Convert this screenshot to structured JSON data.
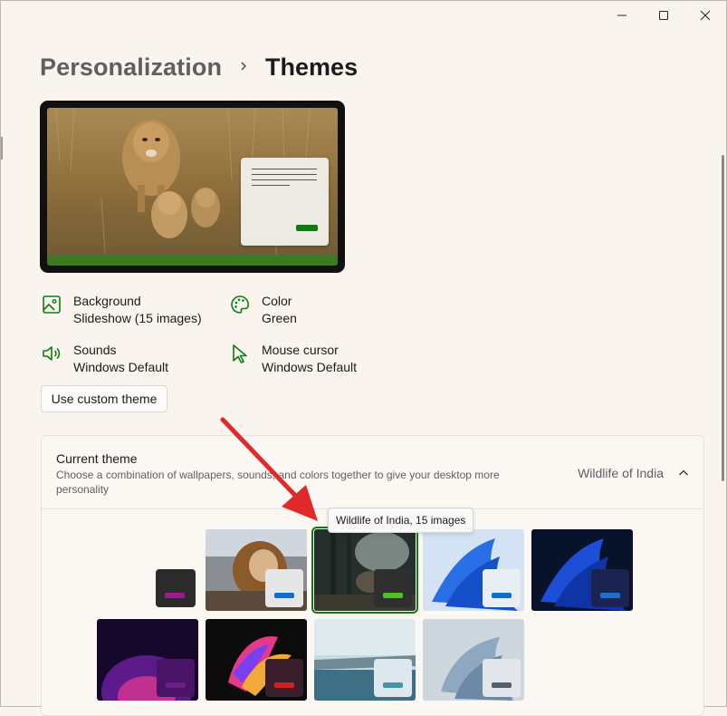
{
  "window": {
    "minimize_icon": "minimize-icon",
    "maximize_icon": "maximize-icon",
    "close_icon": "close-icon"
  },
  "breadcrumb": {
    "parent": "Personalization",
    "current": "Themes"
  },
  "properties": [
    {
      "title": "Background",
      "value": "Slideshow (15 images)",
      "icon": "image-icon"
    },
    {
      "title": "Color",
      "value": "Green",
      "icon": "palette-icon"
    },
    {
      "title": "Sounds",
      "value": "Windows Default",
      "icon": "speaker-icon"
    },
    {
      "title": "Mouse cursor",
      "value": "Windows Default",
      "icon": "cursor-icon"
    }
  ],
  "custom_theme_button": "Use custom theme",
  "current_theme": {
    "title": "Current theme",
    "description": "Choose a combination of wallpapers, sounds, and colors together to give your desktop more personality",
    "value": "Wildlife of India"
  },
  "tooltip": "Wildlife of India, 15 images",
  "colors": {
    "accent": "#107c10",
    "arrow": "#e02a2a"
  }
}
